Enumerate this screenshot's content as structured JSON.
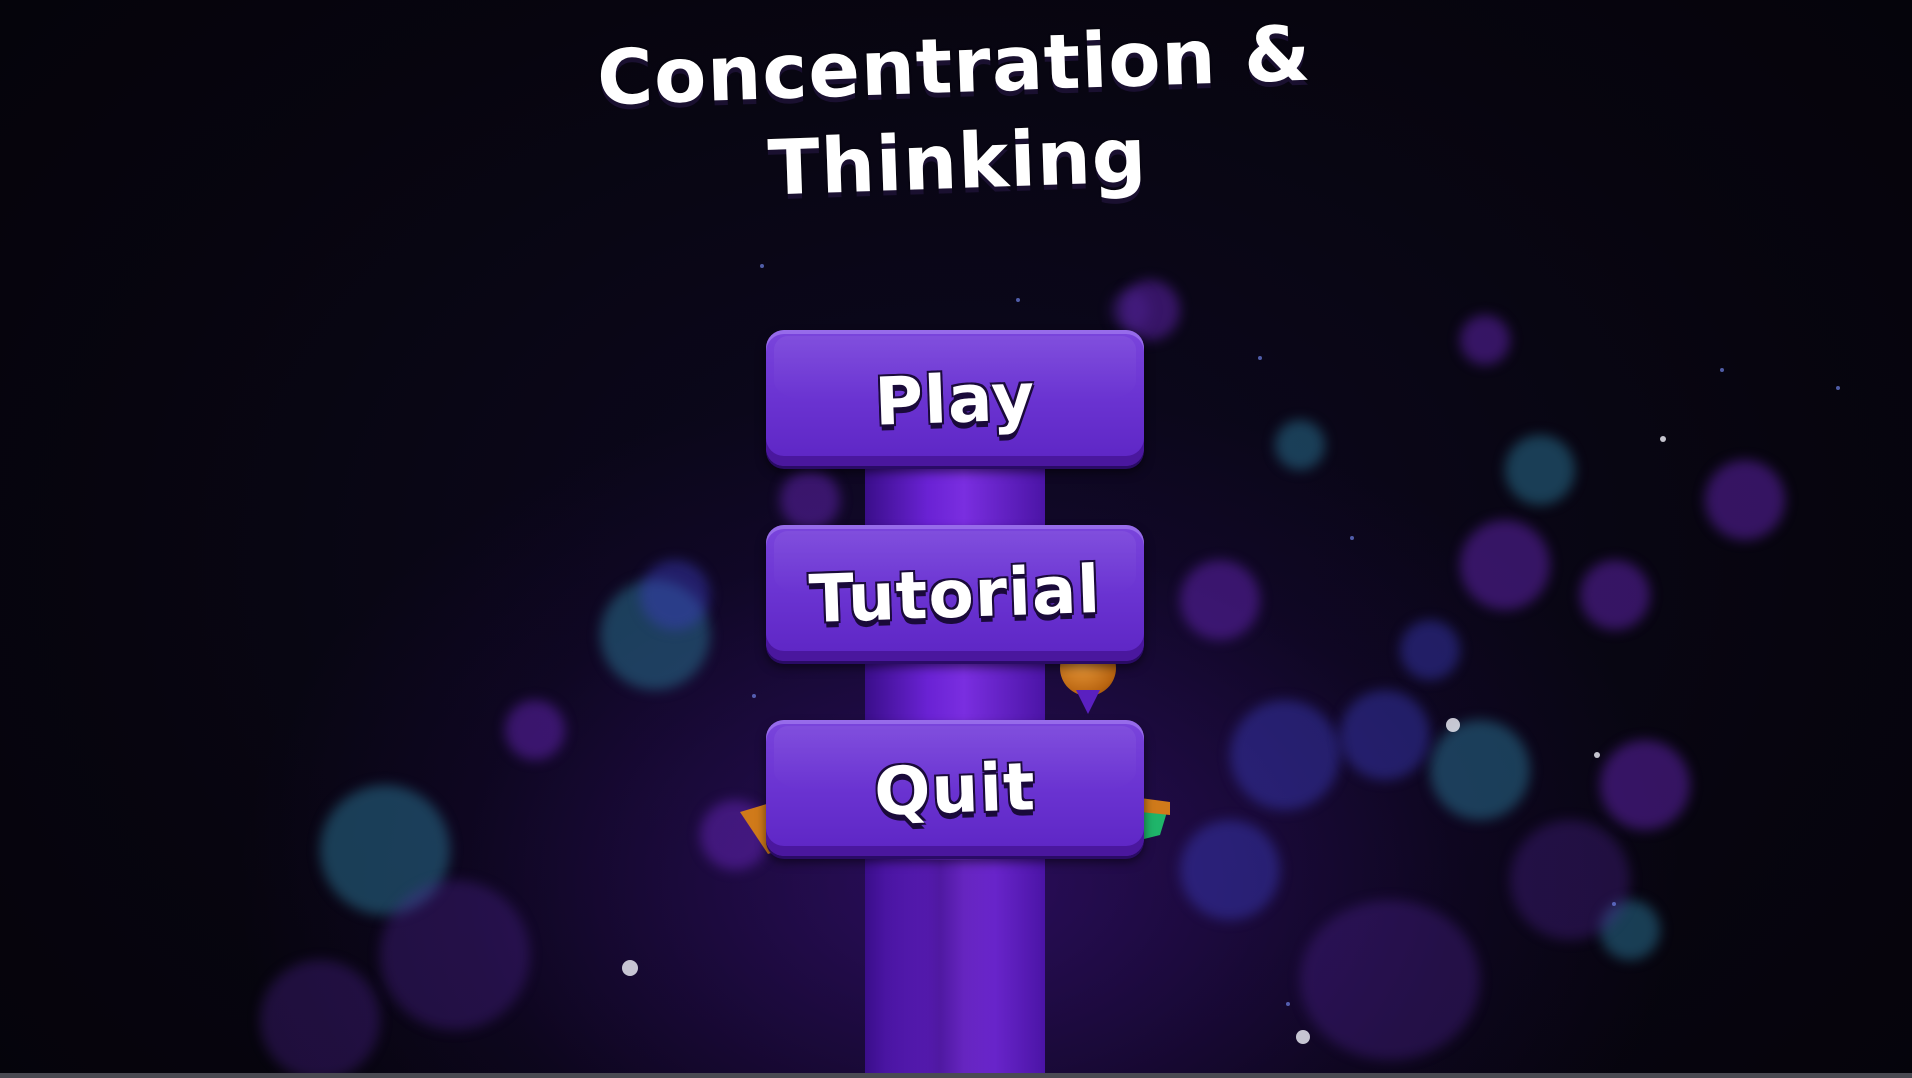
{
  "game": {
    "title_line1": "Concentration &",
    "title_line2": "Thinking"
  },
  "menu": {
    "play_label": "Play",
    "tutorial_label": "Tutorial",
    "quit_label": "Quit"
  },
  "colors": {
    "button_fill": "#6b34d2",
    "button_shadow": "#4a179e",
    "pillar": "#6a22d4",
    "platform_green": "#1fb56a",
    "platform_orange": "#d07a1a",
    "ball": "#c8701a",
    "background": "#06040d"
  }
}
